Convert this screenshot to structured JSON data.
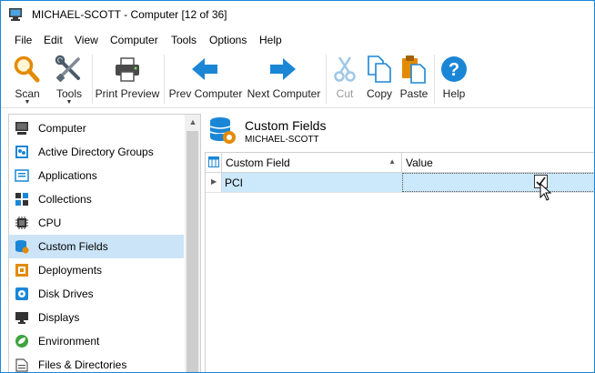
{
  "window": {
    "title": "MICHAEL-SCOTT - Computer [12 of 36]"
  },
  "menu": [
    "File",
    "Edit",
    "View",
    "Computer",
    "Tools",
    "Options",
    "Help"
  ],
  "toolbar": {
    "scan": "Scan",
    "tools": "Tools",
    "print_preview": "Print Preview",
    "prev_computer": "Prev Computer",
    "next_computer": "Next Computer",
    "cut": "Cut",
    "copy": "Copy",
    "paste": "Paste",
    "help": "Help"
  },
  "tree": {
    "items": [
      {
        "label": "Computer",
        "icon": "computer-icon"
      },
      {
        "label": "Active Directory Groups",
        "icon": "ad-groups-icon"
      },
      {
        "label": "Applications",
        "icon": "applications-icon"
      },
      {
        "label": "Collections",
        "icon": "collections-icon"
      },
      {
        "label": "CPU",
        "icon": "cpu-icon"
      },
      {
        "label": "Custom Fields",
        "icon": "custom-fields-icon",
        "selected": true
      },
      {
        "label": "Deployments",
        "icon": "deployments-icon"
      },
      {
        "label": "Disk Drives",
        "icon": "disk-drives-icon"
      },
      {
        "label": "Displays",
        "icon": "displays-icon"
      },
      {
        "label": "Environment",
        "icon": "environment-icon"
      },
      {
        "label": "Files & Directories",
        "icon": "files-directories-icon"
      }
    ]
  },
  "panel": {
    "title": "Custom Fields",
    "subtitle": "MICHAEL-SCOTT"
  },
  "grid": {
    "columns": [
      "Custom Field",
      "Value"
    ],
    "rows": [
      {
        "field": "PCI",
        "value_checked": true
      }
    ]
  },
  "colors": {
    "accent": "#1b86d6",
    "selection": "#cce4f7",
    "row_selected": "#cce8fb"
  }
}
